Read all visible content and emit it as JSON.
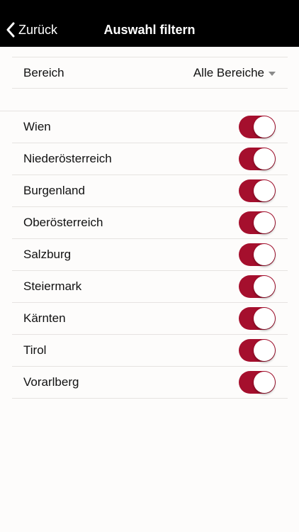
{
  "nav": {
    "back_label": "Zurück",
    "title": "Auswahl filtern"
  },
  "filter": {
    "label": "Bereich",
    "selected": "Alle Bereiche"
  },
  "regions": [
    {
      "label": "Wien",
      "enabled": true
    },
    {
      "label": "Niederösterreich",
      "enabled": true
    },
    {
      "label": "Burgenland",
      "enabled": true
    },
    {
      "label": "Oberösterreich",
      "enabled": true
    },
    {
      "label": "Salzburg",
      "enabled": true
    },
    {
      "label": "Steiermark",
      "enabled": true
    },
    {
      "label": "Kärnten",
      "enabled": true
    },
    {
      "label": "Tirol",
      "enabled": true
    },
    {
      "label": "Vorarlberg",
      "enabled": true
    }
  ],
  "colors": {
    "toggle_on": "#a50f2d",
    "nav_background": "#000000"
  },
  "icons": {
    "back": "chevron-left-icon",
    "dropdown": "caret-down-icon"
  }
}
